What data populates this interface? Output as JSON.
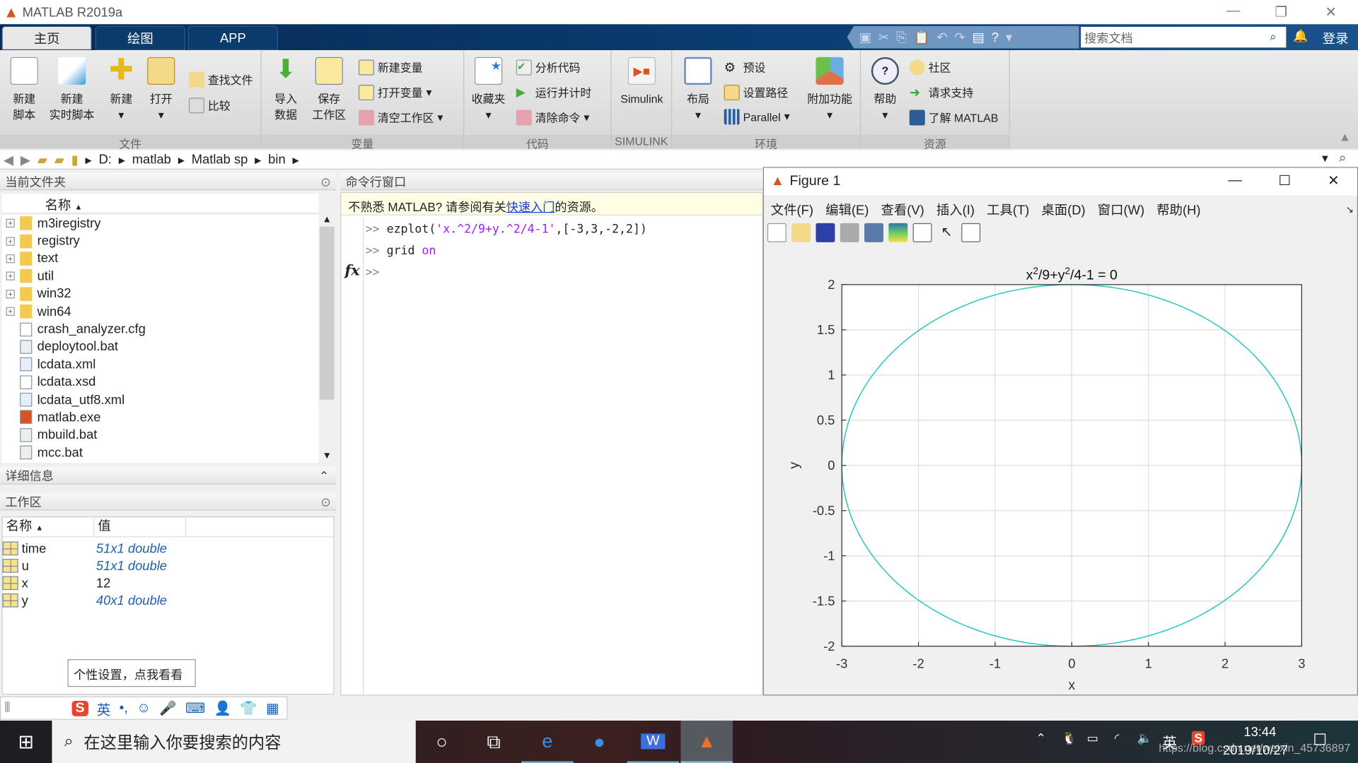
{
  "app": {
    "title": "MATLAB R2019a"
  },
  "tabs": [
    {
      "label": "主页"
    },
    {
      "label": "绘图"
    },
    {
      "label": "APP"
    }
  ],
  "topbar": {
    "search_placeholder": "搜索文档",
    "login": "登录"
  },
  "ribbon": {
    "groups": [
      "文件",
      "变量",
      "代码",
      "SIMULINK",
      "环境",
      "资源"
    ],
    "file": {
      "new_script": [
        "新建",
        "脚本"
      ],
      "new_live": [
        "新建",
        "实时脚本"
      ],
      "new": "新建",
      "open": "打开",
      "find_files": "查找文件",
      "compare": "比较"
    },
    "variable": {
      "import": [
        "导入",
        "数据"
      ],
      "save_ws": [
        "保存",
        "工作区"
      ],
      "new_var": "新建变量",
      "open_var": "打开变量",
      "clear_ws": "清空工作区"
    },
    "code": {
      "favorites": "收藏夹",
      "analyze": "分析代码",
      "run_time": "运行并计时",
      "clear_cmd": "清除命令"
    },
    "simulink": {
      "label": "Simulink"
    },
    "env": {
      "layout": "布局",
      "prefs": "预设",
      "set_path": "设置路径",
      "parallel": "Parallel",
      "addons": "附加功能"
    },
    "resources": {
      "help": "帮助",
      "community": "社区",
      "support": "请求支持",
      "learn": "了解 MATLAB"
    }
  },
  "address": {
    "path": [
      "D:",
      "matlab",
      "Matlab sp",
      "bin"
    ]
  },
  "current_folder": {
    "title": "当前文件夹",
    "col_name": "名称",
    "items": [
      {
        "name": "m3iregistry",
        "type": "folder"
      },
      {
        "name": "registry",
        "type": "folder"
      },
      {
        "name": "text",
        "type": "folder"
      },
      {
        "name": "util",
        "type": "folder"
      },
      {
        "name": "win32",
        "type": "folder"
      },
      {
        "name": "win64",
        "type": "folder"
      },
      {
        "name": "crash_analyzer.cfg",
        "type": "file"
      },
      {
        "name": "deploytool.bat",
        "type": "bat"
      },
      {
        "name": "lcdata.xml",
        "type": "xml"
      },
      {
        "name": "lcdata.xsd",
        "type": "file"
      },
      {
        "name": "lcdata_utf8.xml",
        "type": "xml"
      },
      {
        "name": "matlab.exe",
        "type": "exe"
      },
      {
        "name": "mbuild.bat",
        "type": "bat"
      },
      {
        "name": "mcc.bat",
        "type": "bat"
      }
    ]
  },
  "details": {
    "title": "详细信息"
  },
  "workspace": {
    "title": "工作区",
    "col_name": "名称",
    "col_value": "值",
    "rows": [
      {
        "name": "time",
        "value": "51x1 double",
        "italic": true
      },
      {
        "name": "u",
        "value": "51x1 double",
        "italic": true
      },
      {
        "name": "x",
        "value": "12",
        "italic": false
      },
      {
        "name": "y",
        "value": "40x1 double",
        "italic": true
      }
    ]
  },
  "command": {
    "title": "命令行窗口",
    "banner_pre": "不熟悉 MATLAB? 请参阅有关",
    "banner_link": "快速入门",
    "banner_post": "的资源。",
    "prompt": ">>",
    "line1_fn": "ezplot(",
    "line1_str": "'x.^2/9+y.^2/4-1'",
    "line1_rest": ",[-3,3,-2,2])",
    "line2_cmd": "grid ",
    "line2_arg": "on",
    "fx": "fx"
  },
  "figure": {
    "title": "Figure 1",
    "menu": [
      "文件(F)",
      "编辑(E)",
      "查看(V)",
      "插入(I)",
      "工具(T)",
      "桌面(D)",
      "窗口(W)",
      "帮助(H)"
    ]
  },
  "chart_data": {
    "type": "line",
    "title": "x^2/9+y^2/4-1 = 0",
    "xlabel": "x",
    "ylabel": "y",
    "xlim": [
      -3,
      3
    ],
    "ylim": [
      -2,
      2
    ],
    "xticks": [
      -3,
      -2,
      -1,
      0,
      1,
      2,
      3
    ],
    "yticks": [
      -2,
      -1.5,
      -1,
      -0.5,
      0,
      0.5,
      1,
      1.5,
      2
    ],
    "grid": true,
    "color": "#25c4c0",
    "equation": "x^2/9+y^2/4-1=0",
    "series": [
      {
        "shape": "ellipse",
        "a": 3,
        "b": 2,
        "center": [
          0,
          0
        ]
      }
    ]
  },
  "ime": {
    "lang": "英",
    "tooltip": "个性设置，点我看看"
  },
  "taskbar": {
    "search_placeholder": "在这里输入你要搜索的内容",
    "time": "13:44",
    "date": "2019/10/27",
    "tray_lang": "英",
    "watermark": "https://blog.csdn.net/weixin_45736897"
  }
}
